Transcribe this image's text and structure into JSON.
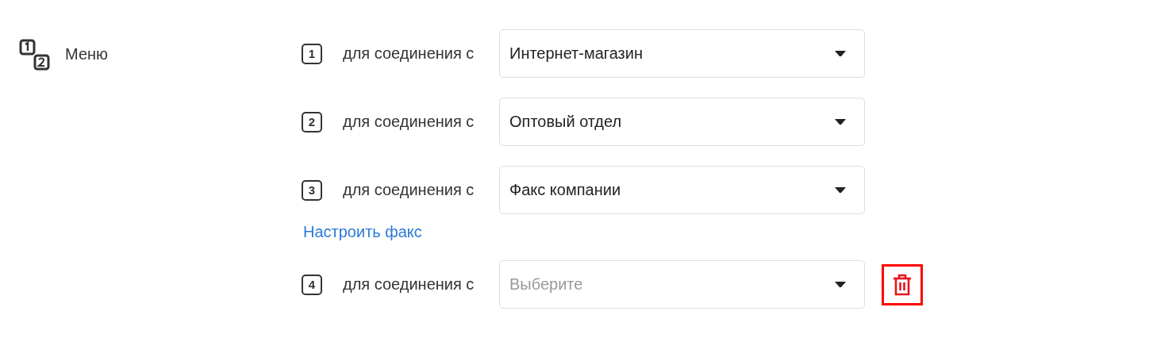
{
  "menu": {
    "title": "Меню"
  },
  "items": [
    {
      "kind": "select",
      "key": "1",
      "label": "для соединения с",
      "value": "Интернет-магазин",
      "removable": false
    },
    {
      "kind": "select",
      "key": "2",
      "label": "для соединения с",
      "value": "Оптовый отдел",
      "removable": false
    },
    {
      "kind": "select",
      "key": "3",
      "label": "для соединения с",
      "value": "Факс компании",
      "removable": false
    },
    {
      "kind": "link",
      "text": "Настроить факс"
    },
    {
      "kind": "select",
      "key": "4",
      "label": "для соединения с",
      "placeholder": "Выберите",
      "removable": true
    }
  ]
}
